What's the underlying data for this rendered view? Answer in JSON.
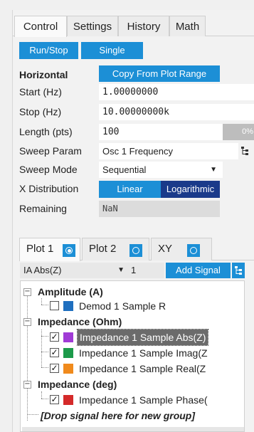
{
  "tabs": [
    "Control",
    "Settings",
    "History",
    "Math"
  ],
  "buttons": {
    "run_stop": "Run/Stop",
    "single": "Single",
    "copy_range": "Copy From Plot Range"
  },
  "horizontal": {
    "heading": "Horizontal",
    "start_label": "Start (Hz)",
    "start_value": "1.00000000",
    "stop_label": "Stop (Hz)",
    "stop_value": "10.00000000k",
    "length_label": "Length (pts)",
    "length_value": "100",
    "length_progress": "0%",
    "sweep_param_label": "Sweep Param",
    "sweep_param_value": "Osc 1 Frequency",
    "sweep_mode_label": "Sweep Mode",
    "sweep_mode_value": "Sequential",
    "x_dist_label": "X Distribution",
    "x_dist_options": [
      "Linear",
      "Logarithmic"
    ],
    "x_dist_selected": "Logarithmic",
    "remaining_label": "Remaining",
    "remaining_value": "NaN"
  },
  "plot_tabs": [
    "Plot 1",
    "Plot 2",
    "XY"
  ],
  "signal_bar": {
    "signal_select": "IA Abs(Z)",
    "index_select": "1",
    "add_signal": "Add Signal"
  },
  "tree": {
    "groups": [
      {
        "label": "Amplitude (A)",
        "signals": [
          {
            "label": "Demod 1 Sample R",
            "checked": false,
            "color": "#1f6fbf"
          }
        ]
      },
      {
        "label": "Impedance (Ohm)",
        "signals": [
          {
            "label": "Impedance 1 Sample Abs(Z)",
            "checked": true,
            "color": "#a03bd6",
            "selected": true
          },
          {
            "label": "Impedance 1 Sample Imag(Z",
            "checked": true,
            "color": "#1c9a4a"
          },
          {
            "label": "Impedance 1 Sample Real(Z",
            "checked": true,
            "color": "#f08a1c"
          }
        ]
      },
      {
        "label": "Impedance (deg)",
        "signals": [
          {
            "label": "Impedance 1 Sample Phase(",
            "checked": true,
            "color": "#d42a2a"
          }
        ]
      }
    ],
    "drop_hint": "[Drop signal here for new group]"
  },
  "colors": {
    "accent": "#1c8fd6",
    "selected_seg": "#1a3a8a"
  }
}
